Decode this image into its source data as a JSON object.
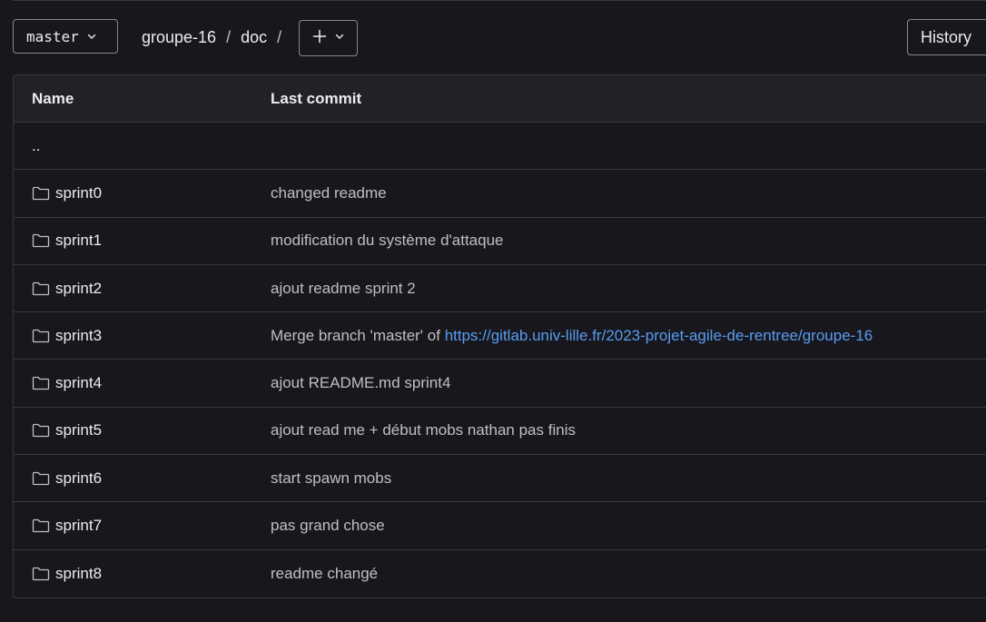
{
  "toolbar": {
    "branch": "master",
    "breadcrumb": [
      "groupe-16",
      "doc"
    ],
    "separator": "/",
    "add_label": "+",
    "history_label": "History"
  },
  "table": {
    "headers": {
      "name": "Name",
      "last_commit": "Last commit"
    },
    "parent_label": "..",
    "rows": [
      {
        "name": "sprint0",
        "commit": "changed readme",
        "link": ""
      },
      {
        "name": "sprint1",
        "commit": "modification du système d'attaque",
        "link": ""
      },
      {
        "name": "sprint2",
        "commit": "ajout readme sprint 2",
        "link": ""
      },
      {
        "name": "sprint3",
        "commit": "Merge branch 'master' of ",
        "link": "https://gitlab.univ-lille.fr/2023-projet-agile-de-rentree/groupe-16"
      },
      {
        "name": "sprint4",
        "commit": "ajout README.md sprint4",
        "link": ""
      },
      {
        "name": "sprint5",
        "commit": "ajout read me + début mobs nathan pas finis",
        "link": ""
      },
      {
        "name": "sprint6",
        "commit": "start spawn mobs",
        "link": ""
      },
      {
        "name": "sprint7",
        "commit": "pas grand chose",
        "link": ""
      },
      {
        "name": "sprint8",
        "commit": "readme changé",
        "link": ""
      }
    ]
  },
  "colors": {
    "background": "#18171d",
    "border": "#3a383f",
    "header_bg": "#222126",
    "text": "#ececef",
    "muted": "#bfbfc3",
    "link": "#589cf0"
  },
  "icons": {
    "branch_dropdown": "chevron-down-icon",
    "add": "plus-icon",
    "add_dropdown": "chevron-down-icon",
    "folder": "folder-icon"
  }
}
